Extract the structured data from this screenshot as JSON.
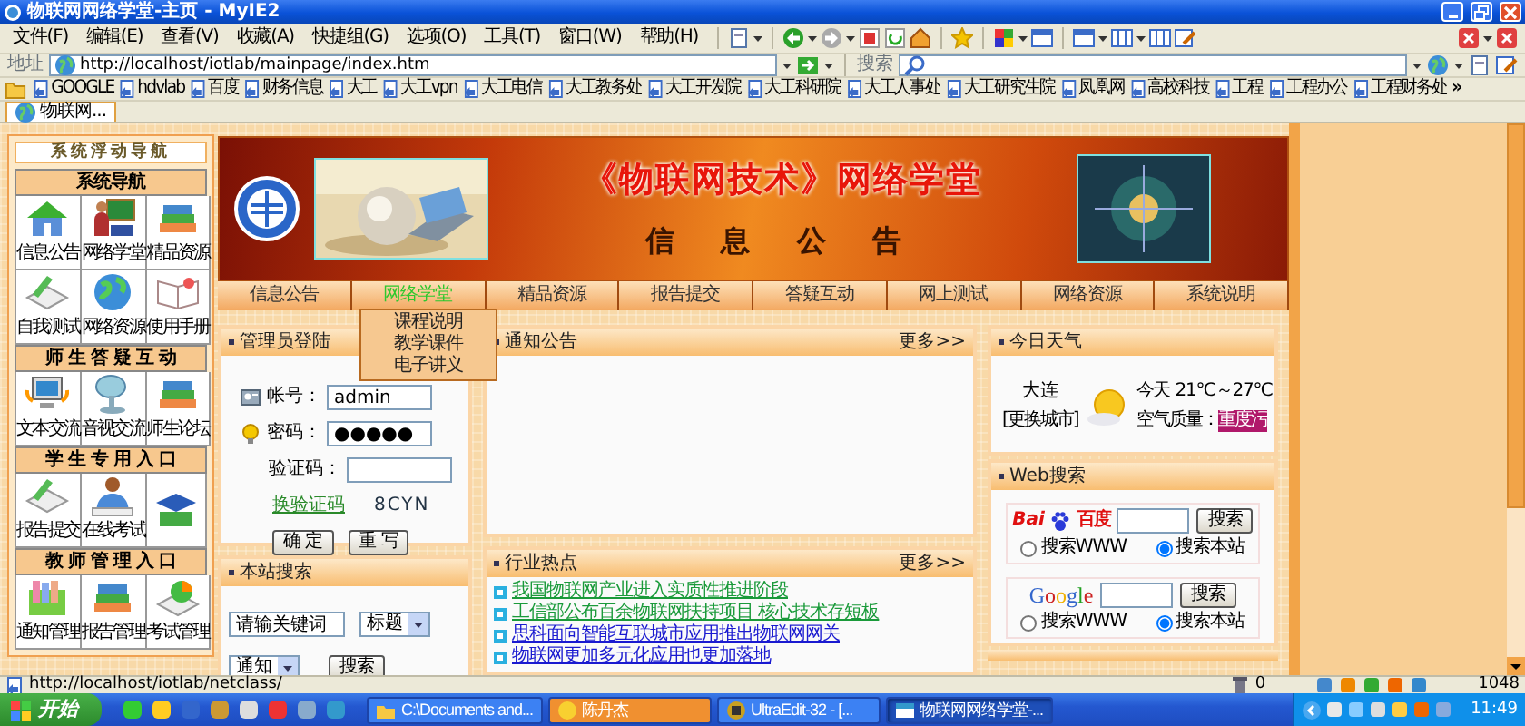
{
  "window": {
    "title": "物联网网络学堂-主页 - MyIE2"
  },
  "menu": [
    "文件(F)",
    "编辑(E)",
    "查看(V)",
    "收藏(A)",
    "快捷组(G)",
    "选项(O)",
    "工具(T)",
    "窗口(W)",
    "帮助(H)"
  ],
  "address": {
    "label": "地址",
    "url": "http://localhost/iotlab/mainpage/index.htm",
    "search_label": "搜索"
  },
  "links": [
    "GOOGLE",
    "hdvlab",
    "百度",
    "财务信息",
    "大工",
    "大工vpn",
    "大工电信",
    "大工教务处",
    "大工开发院",
    "大工科研院",
    "大工人事处",
    "大工研究生院",
    "凤凰网",
    "高校科技",
    "工程",
    "工程办公",
    "工程财务处"
  ],
  "links_more": "»",
  "tabs": [
    {
      "label": "物联网...",
      "selected": true
    }
  ],
  "nav": {
    "title": "系统浮动导航",
    "sections": [
      {
        "title": "系统导航",
        "items": [
          {
            "label": "信息公告"
          },
          {
            "label": "网络学堂"
          },
          {
            "label": "精品资源"
          },
          {
            "label": "自我测试"
          },
          {
            "label": "网络资源"
          },
          {
            "label": "使用手册"
          }
        ]
      },
      {
        "title": "师 生 答 疑 互 动",
        "items": [
          {
            "label": "文本交流"
          },
          {
            "label": "音视交流"
          },
          {
            "label": "师生论坛"
          }
        ]
      },
      {
        "title": "学 生 专 用 入 口",
        "items": [
          {
            "label": "报告提交"
          },
          {
            "label": "在线考试"
          },
          {
            "kind": "icon_only"
          }
        ]
      },
      {
        "title": "教 师 管 理 入 口",
        "items": [
          {
            "label": "通知管理"
          },
          {
            "label": "报告管理"
          },
          {
            "label": "考试管理"
          }
        ]
      }
    ]
  },
  "banner": {
    "title": "《物联网技术》网络学堂",
    "subtitle": "信 息 公 告"
  },
  "site_tabs": [
    {
      "label": "信息公告",
      "selected": false
    },
    {
      "label": "网络学堂",
      "selected": true
    },
    {
      "label": "精品资源",
      "selected": false
    },
    {
      "label": "报告提交",
      "selected": false
    },
    {
      "label": "答疑互动",
      "selected": false
    },
    {
      "label": "网上测试",
      "selected": false
    },
    {
      "label": "网络资源",
      "selected": false
    },
    {
      "label": "系统说明",
      "selected": false
    }
  ],
  "dropdown": [
    "课程说明",
    "教学课件",
    "电子讲义"
  ],
  "login": {
    "title": "管理员登陆",
    "account_label": "帐号：",
    "account": "admin",
    "password_label": "密码：",
    "password": "●●●●●",
    "captcha_label": "验证码：",
    "change_captcha": "换验证码",
    "captcha": "8CYN",
    "buttons": [
      "确 定",
      "重 写"
    ]
  },
  "site_search": {
    "title": "本站搜索",
    "keyword": "请输关键词",
    "field": "标题",
    "type": "通知",
    "button": "搜索"
  },
  "notice": {
    "title": "通知公告",
    "more": "更多>>"
  },
  "industry": {
    "title": "行业热点",
    "more": "更多>>",
    "items": [
      {
        "text": "我国物联网产业进入实质性推进阶段",
        "visited": true
      },
      {
        "text": "工信部公布百余物联网扶持项目 核心技术存短板",
        "visited": true
      },
      {
        "text": "思科面向智能互联城市应用推出物联网网关",
        "visited": false
      },
      {
        "text": "物联网更加多元化应用也更加落地",
        "visited": false
      }
    ]
  },
  "weather": {
    "title": "今日天气",
    "city": "大连",
    "change_city": "[更换城市]",
    "forecast": "今天 21℃～27℃",
    "air_label": "空气质量：",
    "air_value": "重度污"
  },
  "web_search": {
    "title": "Web搜索",
    "engines": [
      {
        "kind": "baidu",
        "logo": [
          "Bai",
          "百度"
        ],
        "button": "搜索",
        "options": [
          {
            "label": "搜索WWW",
            "selected": false
          },
          {
            "label": "搜索本站",
            "selected": true
          }
        ]
      },
      {
        "kind": "google",
        "logo": [
          "Google"
        ],
        "button": "搜索",
        "options": [
          {
            "label": "搜索WWW",
            "selected": false
          },
          {
            "label": "搜索本站",
            "selected": true
          }
        ]
      }
    ]
  },
  "status_bar": {
    "url": "http://localhost/iotlab/netclass/",
    "count": "0",
    "zoom": "1048"
  },
  "taskbar": {
    "start": "开始",
    "windows": [
      {
        "label": "C:\\Documents and...",
        "selected": false,
        "flashing": false
      },
      {
        "label": "陈丹杰",
        "selected": false,
        "flashing": true
      },
      {
        "label": "UltraEdit-32 - [...",
        "selected": false,
        "flashing": false
      },
      {
        "label": "物联网网络学堂-...",
        "selected": true,
        "flashing": false
      }
    ],
    "clock": "11:49"
  }
}
